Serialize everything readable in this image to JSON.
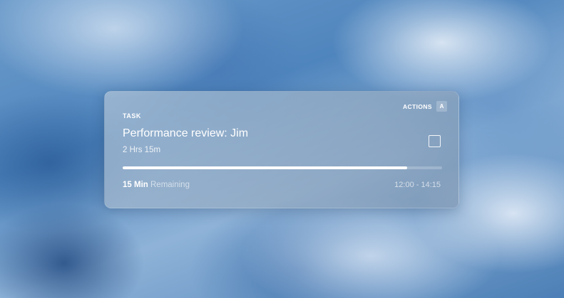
{
  "task_card": {
    "label": "TASK",
    "actions_label": "ACTIONS",
    "actions_shortcut": "A",
    "title": "Performance review: Jim",
    "duration": "2 Hrs 15m",
    "progress_fraction": 0.89,
    "remaining_value": "15 Min",
    "remaining_suffix": "Remaining",
    "time_range": "12:00 - 14:15",
    "checkbox_checked": false,
    "icons": {
      "checkbox": "checkbox-icon"
    }
  }
}
